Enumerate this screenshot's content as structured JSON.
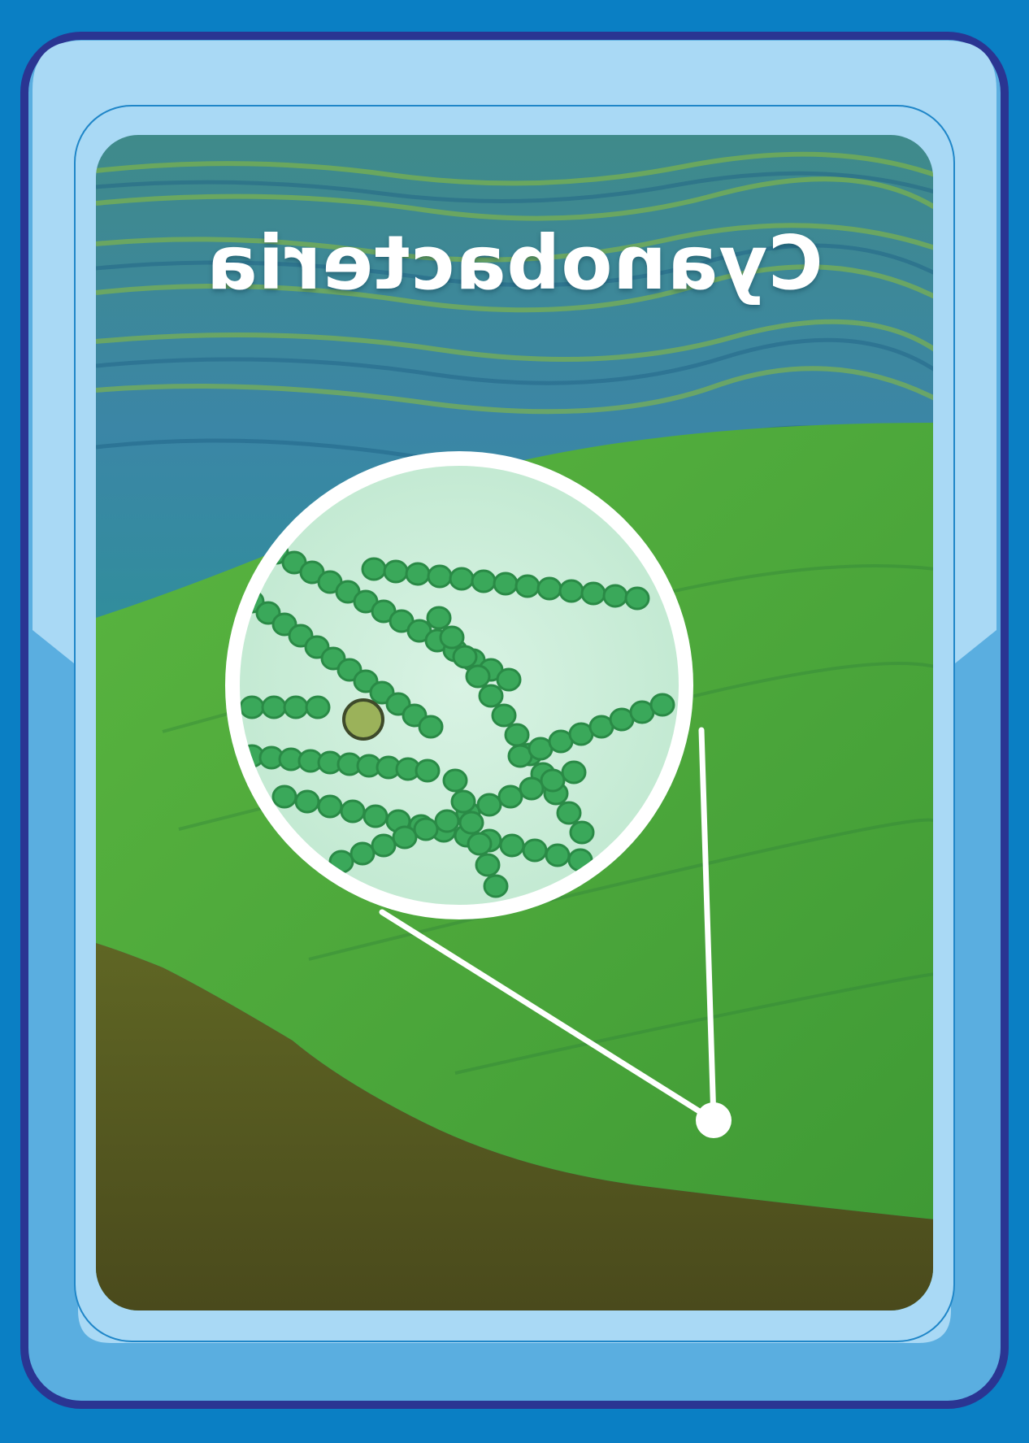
{
  "card": {
    "title": "Cyanobacteria",
    "title_mirrored": true
  },
  "icons": {
    "magnifier": "magnifier-callout-icon",
    "pointer": "callout-pointer-dot"
  },
  "colors": {
    "background": "#0a7fc4",
    "frame_border": "#2a3592",
    "frame_fill_light": "#a9d9f5",
    "frame_fill_mid": "#5aaee0",
    "water_blue": "#2f7fa0",
    "algae_green": "#4fae3a",
    "mud": "#5a5a22",
    "micro_bg": "#cfeedd",
    "cell_green": "#3aa85a",
    "white": "#ffffff"
  }
}
